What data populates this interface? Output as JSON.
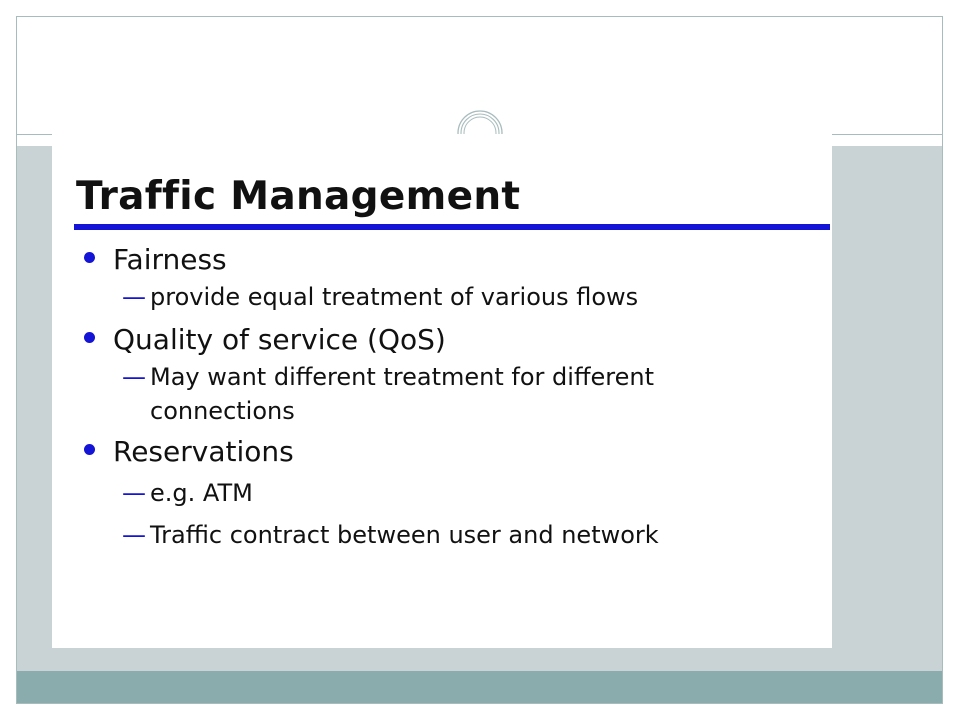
{
  "slide": {
    "title": "Traffic Management",
    "bullets": [
      {
        "text": "Fairness",
        "subs": [
          "provide equal treatment of various flows"
        ]
      },
      {
        "text": "Quality of service (QoS)",
        "subs": [
          "May want different treatment for different connections"
        ]
      },
      {
        "text": "Reservations",
        "subs": [
          "e.g. ATM",
          "Traffic contract between user and network"
        ]
      }
    ]
  },
  "colors": {
    "accent": "#1414d6",
    "band": "#c9d2d4",
    "footer": "#8aacad",
    "border": "#a9bcbd"
  },
  "icons": [
    "concentric-arc-ornament-icon",
    "bullet-dot-icon",
    "dash-icon"
  ]
}
